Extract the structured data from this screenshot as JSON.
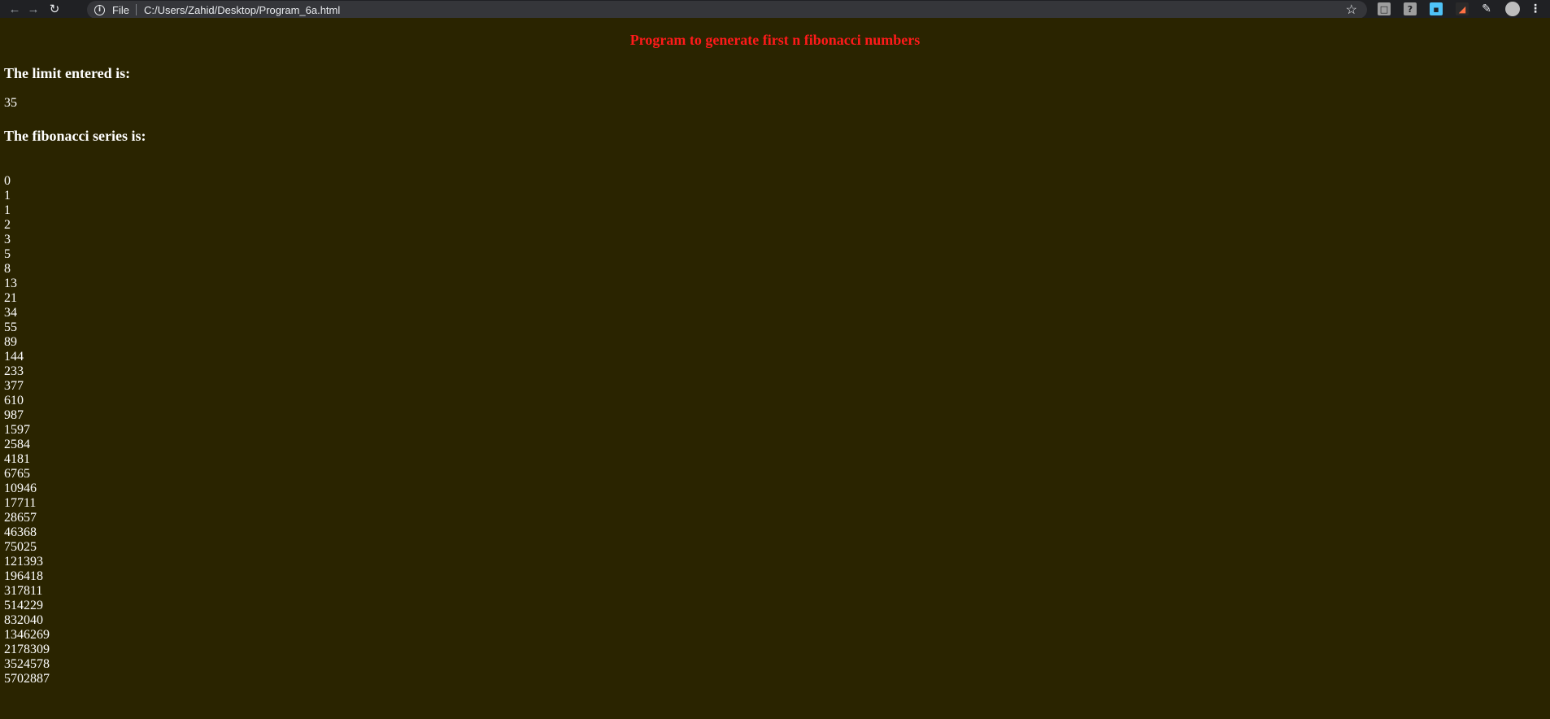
{
  "browser": {
    "scheme_label": "File",
    "url": "C:/Users/Zahid/Desktop/Program_6a.html",
    "nav": {
      "back_icon": "arrow-left-icon",
      "forward_icon": "arrow-right-icon",
      "reload_icon": "reload-icon"
    },
    "extensions": [
      {
        "name": "extension-1-icon",
        "color": "#9e9e9e"
      },
      {
        "name": "extension-help-icon",
        "color": "#9e9e9e",
        "glyph": "?"
      },
      {
        "name": "extension-3-icon",
        "color": "#4fc3f7"
      },
      {
        "name": "extension-4-icon",
        "color": "#ff7043"
      },
      {
        "name": "extensions-puzzle-icon",
        "color": "#e8eaed"
      },
      {
        "name": "profile-avatar",
        "color": "#bdbdbd"
      },
      {
        "name": "menu-icon",
        "color": "#e8eaed"
      }
    ]
  },
  "page": {
    "title": "Program to generate first n fibonacci numbers",
    "limit_heading": "The limit entered is:",
    "limit_value": "35",
    "series_heading": "The fibonacci series is:",
    "series": [
      "0",
      "1",
      "1",
      "2",
      "3",
      "5",
      "8",
      "13",
      "21",
      "34",
      "55",
      "89",
      "144",
      "233",
      "377",
      "610",
      "987",
      "1597",
      "2584",
      "4181",
      "6765",
      "10946",
      "17711",
      "28657",
      "46368",
      "75025",
      "121393",
      "196418",
      "317811",
      "514229",
      "832040",
      "1346269",
      "2178309",
      "3524578",
      "5702887"
    ]
  },
  "colors": {
    "background": "#2a2400",
    "title": "#ff1a1a",
    "text": "#ffffff"
  }
}
